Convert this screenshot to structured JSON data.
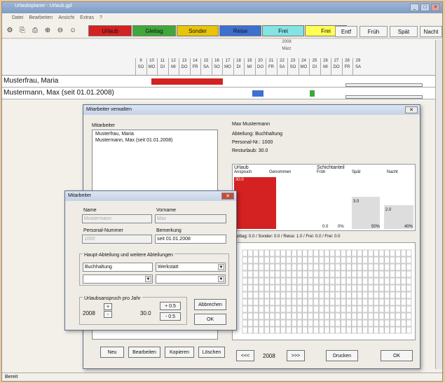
{
  "window": {
    "title": "Urlaubsplaner - Urlaub.gpl"
  },
  "menu": [
    "Datei",
    "Bearbeiten",
    "Ansicht",
    "Extras",
    "?"
  ],
  "toolbar": {
    "absence_buttons": [
      {
        "label": "Urlaub",
        "color": "#d42121"
      },
      {
        "label": "Gleitag",
        "color": "#3fa83a"
      },
      {
        "label": "Sonder",
        "color": "#e8c40a"
      },
      {
        "label": "Reise",
        "color": "#3f6fcf"
      },
      {
        "label": "Frei",
        "color": "#84e3e3"
      },
      {
        "label": "Frei",
        "color": "#ffff55"
      }
    ],
    "shift_buttons": [
      "Entf",
      "Früh",
      "Spät",
      "Nacht"
    ]
  },
  "calendar": {
    "year": "2008",
    "month": "März",
    "days": [
      {
        "d": "9",
        "w": "SO"
      },
      {
        "d": "10",
        "w": "MO"
      },
      {
        "d": "11",
        "w": "DI"
      },
      {
        "d": "12",
        "w": "MI"
      },
      {
        "d": "13",
        "w": "DO"
      },
      {
        "d": "14",
        "w": "FR"
      },
      {
        "d": "15",
        "w": "SA"
      },
      {
        "d": "16",
        "w": "SO"
      },
      {
        "d": "17",
        "w": "MO"
      },
      {
        "d": "18",
        "w": "DI"
      },
      {
        "d": "19",
        "w": "MI"
      },
      {
        "d": "20",
        "w": "DO"
      },
      {
        "d": "21",
        "w": "FR"
      },
      {
        "d": "22",
        "w": "SA"
      },
      {
        "d": "23",
        "w": "SO"
      },
      {
        "d": "24",
        "w": "MO"
      },
      {
        "d": "25",
        "w": "DI"
      },
      {
        "d": "26",
        "w": "MI"
      },
      {
        "d": "27",
        "w": "DO"
      },
      {
        "d": "28",
        "w": "FR"
      },
      {
        "d": "29",
        "w": "SA"
      }
    ],
    "employees": [
      "Musterfrau, Maria",
      "Mustermann, Max (seit 01.01.2008)"
    ]
  },
  "status": "Bereit",
  "verwalten": {
    "title": "Mitarbeiter verwalten",
    "list_label": "Mitarbeiter",
    "list": [
      "Musterfrau, Maria",
      "Mustermann, Max (seit 01.01.2008)"
    ],
    "detail_name": "Max Mustermann",
    "detail_abteilung": "Abteilung: Buchhaltung",
    "detail_personalnr": "Personal-Nr.: 1000",
    "detail_resturlaub": "Resturlaub: 30.0",
    "urlaub_label": "Urlaub",
    "anspruch_label": "Anspruch",
    "genommen_label": "Genommen",
    "schicht_label": "Schichtanteil",
    "fruh": "Früh",
    "spat": "Spät",
    "nacht": "Nacht",
    "v_30": "30.0",
    "v_00": "0.0",
    "v_0pct": "0%",
    "v_spat": "3.0",
    "v_50pct": "50%",
    "v_nacht": "2.0",
    "v_40pct": "40%",
    "summary": "Gleittag: 0.0 / Sonder: 0.0 / Reise: 1.0 / Frei: 0.0 / Frei: 0.0",
    "year": "2008",
    "prev": "<<<",
    "next": ">>>",
    "buttons": [
      "Neu",
      "Bearbeiten",
      "Kopieren",
      "Löschen"
    ],
    "drucken": "Drucken",
    "ok": "OK"
  },
  "mitarbeiter": {
    "title": "Mitarbeiter",
    "name_label": "Name",
    "name_val": "Mustermann",
    "vorname_label": "Vorname",
    "vorname_val": "Max",
    "pnr_label": "Personal-Nummer",
    "pnr_val": "1000",
    "bem_label": "Bemerkung",
    "bem_val": "seit 01.01.2008",
    "abt_label": "Haupt-Abteilung und weitere Abteilungen",
    "abt_main": "Buchhaltung",
    "abt_2": "Werkstatt",
    "urlaub_group": "Urlaubsanspruch pro Jahr",
    "urlaub_year": "2008",
    "urlaub_val": "30.0",
    "plus": "+",
    "minus": "-",
    "plus05": "+ 0.5",
    "minus05": "- 0.5",
    "abbrechen": "Abbrechen",
    "ok": "OK"
  }
}
